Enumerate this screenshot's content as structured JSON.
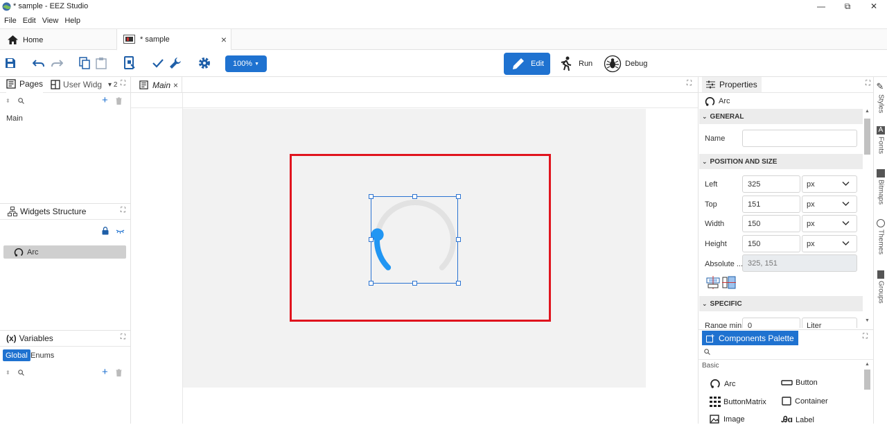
{
  "window": {
    "title": "* sample - EEZ Studio",
    "minimize": "—",
    "restore": "⧉",
    "close": "✕"
  },
  "menu": [
    "File",
    "Edit",
    "View",
    "Help"
  ],
  "tabs": {
    "home": "Home",
    "document": "* sample",
    "close": "×"
  },
  "toolbar": {
    "zoom": "100%",
    "edit": "Edit",
    "run": "Run",
    "debug": "Debug"
  },
  "pages_panel": {
    "tab_pages": "Pages",
    "tab_user_widgets": "User Widg",
    "more_tabs": "▾ 2",
    "items": [
      "Main"
    ]
  },
  "widgets_structure": {
    "title": "Widgets Structure",
    "items": [
      "Arc"
    ]
  },
  "variables_panel": {
    "title": "Variables",
    "icon_text": "(x)",
    "tab_global": "Global",
    "tab_enums": "Enums"
  },
  "editor": {
    "tab_label": "Main",
    "tab_close": "×"
  },
  "properties": {
    "title": "Properties",
    "object_type": "Arc",
    "sections": {
      "general": "GENERAL",
      "position": "POSITION AND SIZE",
      "specific": "SPECIFIC"
    },
    "fields": {
      "name_label": "Name",
      "name_value": "",
      "left_label": "Left",
      "left_value": "325",
      "left_unit": "px",
      "top_label": "Top",
      "top_value": "151",
      "top_unit": "px",
      "width_label": "Width",
      "width_value": "150",
      "width_unit": "px",
      "height_label": "Height",
      "height_value": "150",
      "height_unit": "px",
      "absolute_label": "Absolute ...",
      "absolute_value": "325, 151",
      "range_min_label": "Range min",
      "range_min_value": "0",
      "range_min_unit": "Liter"
    }
  },
  "side_tabs": [
    "Styles",
    "Fonts",
    "Bitmaps",
    "Themes",
    "Groups"
  ],
  "palette": {
    "title": "Components Palette",
    "group": "Basic",
    "items": [
      "Arc",
      "Button",
      "ButtonMatrix",
      "Container",
      "Image",
      "Label"
    ]
  },
  "colors": {
    "accent": "#1f72d0",
    "selection_red": "#e0141e",
    "arc_indicator": "#2196f3",
    "arc_track": "#e2e2e2"
  },
  "arc_widget": {
    "range_min": 0,
    "range_max": 100,
    "value": 20
  }
}
